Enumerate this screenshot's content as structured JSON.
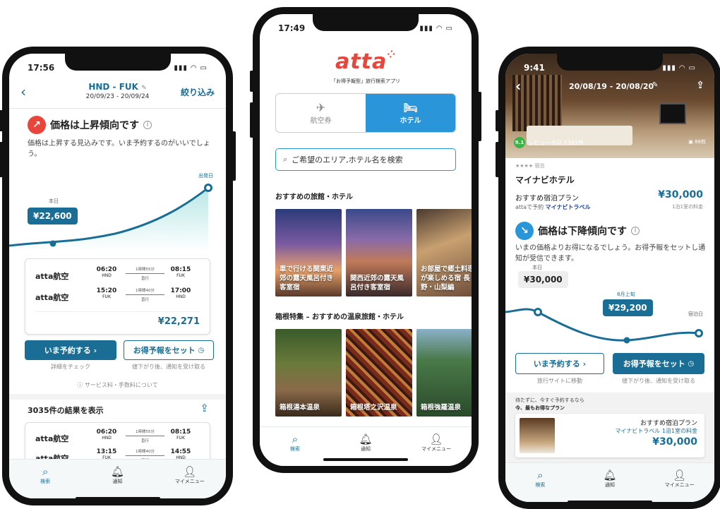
{
  "colors": {
    "accent": "#1a6e96",
    "up": "#e8463c",
    "down": "#2a95d8",
    "brand": "#e8463c"
  },
  "nav": {
    "search": "検索",
    "notify": "通知",
    "mymenu": "マイメニュー"
  },
  "phone1": {
    "time": "17:56",
    "route": "HND - FUK",
    "dates": "20/09/23 - 20/09/24",
    "filter": "絞り込み",
    "trend_title": "価格は上昇傾向です",
    "trend_desc": "価格は上昇する見込みです。いま予約するのがいいでしょう。",
    "label_today": "本日",
    "label_departure": "出発日",
    "today_price": "¥22,600",
    "card": {
      "flights": [
        {
          "airline": "atta航空",
          "dep_time": "06:20",
          "dep_code": "HND",
          "duration": "1時間55分",
          "type": "直行",
          "arr_time": "08:15",
          "arr_code": "FUK"
        },
        {
          "airline": "atta航空",
          "dep_time": "15:20",
          "dep_code": "FUK",
          "duration": "1時間40分",
          "type": "直行",
          "arr_time": "17:00",
          "arr_code": "HND"
        }
      ],
      "price": "¥22,271"
    },
    "book_now": "いま予約する",
    "set_alert": "お得予報をセット",
    "book_caption": "詳細をチェック",
    "alert_caption": "値下がり後、通知を受け取る",
    "fee_note": "サービス料・手数料について",
    "results": "3035件の結果を表示",
    "results_flights": [
      {
        "airline": "atta航空",
        "dep_time": "06:20",
        "dep_code": "HND",
        "duration": "1時間55分",
        "type": "直行",
        "arr_time": "08:15",
        "arr_code": "FUK"
      },
      {
        "airline": "atta航空",
        "dep_time": "13:15",
        "dep_code": "FUK",
        "duration": "1時間40分",
        "type": "直行",
        "arr_time": "14:55",
        "arr_code": "HND"
      }
    ]
  },
  "phone2": {
    "time": "17:49",
    "logo": "atta",
    "tagline": "「お得予報型」旅行検索アプリ",
    "tab_flight": "航空券",
    "tab_hotel": "ホテル",
    "search_placeholder": "ご希望のエリア,ホテル名を検索",
    "section1": "おすすめの旅館・ホテル",
    "tiles1": [
      "車で行ける関東近郊の露天風呂付き客室宿",
      "関西近郊の露天風呂付き客室宿",
      "お部屋で郷土料理が楽しめる宿 長野・山梨編"
    ],
    "section2": "箱根特集 – おすすめの温泉旅館・ホテル",
    "tiles2": [
      "箱根湯本温泉",
      "箱根塔之沢温泉",
      "箱根強羅温泉"
    ]
  },
  "phone3": {
    "time": "9:41",
    "dates": "20/08/19 - 20/08/20",
    "rating": "9.1",
    "reviews": "レビュー合計 1381件",
    "photos": "88枚",
    "stars": "★★★★ 宿泊",
    "hotel": "マイナビホテル",
    "plan": "おすすめ宿泊プラン",
    "price": "¥30,000",
    "book_on": "attaで予約",
    "partner": "マイナビトラベル",
    "per_room": "1泊1室の料金",
    "trend_title": "価格は下降傾向です",
    "trend_desc": "いまの価格よりお得になるでしょう。お得予報をセットし通知が受信できます。",
    "label_today": "本日",
    "label_early_aug": "8月上旬",
    "label_stay": "宿泊日",
    "today_price": "¥30,000",
    "forecast_price": "¥29,200",
    "book_now": "いま予約する",
    "set_alert": "お得予報をセット",
    "book_caption": "旅行サイトに移動",
    "alert_caption": "値下がり後、通知を受け取る",
    "panel_note1": "待たずに、今すぐ予約するなら",
    "panel_note2": "今、最もお得なプラン",
    "offer_plan": "おすすめ宿泊プラン",
    "offer_partner": "マイナビトラベル 1泊1室の料金",
    "offer_price": "¥30,000"
  }
}
